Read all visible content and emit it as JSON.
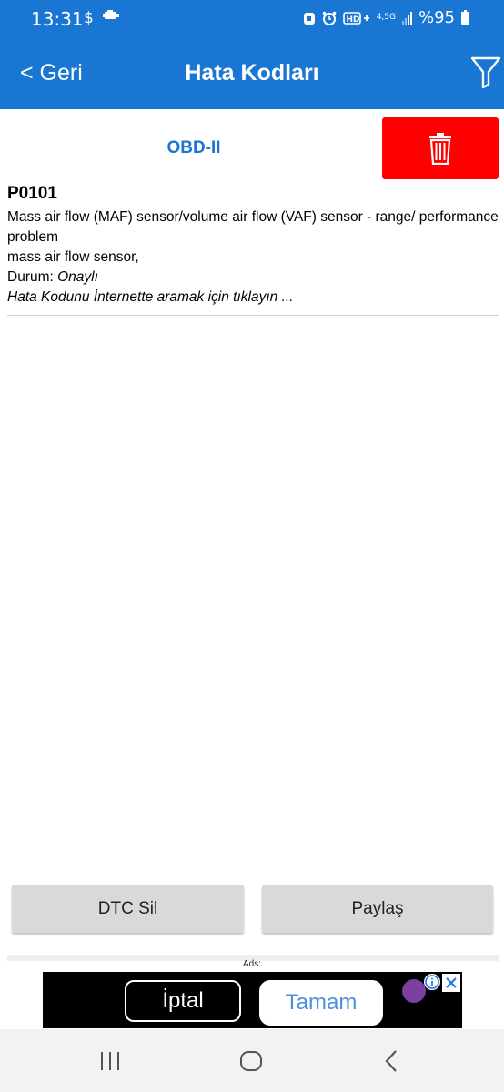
{
  "status_bar": {
    "time": "13:31",
    "network_badge": "4,5G",
    "battery": "%95"
  },
  "header": {
    "back_label": "< Geri",
    "title": "Hata Kodları"
  },
  "segment": {
    "label": "OBD-II"
  },
  "dtc_list": [
    {
      "code": "P0101",
      "description": "Mass air flow (MAF) sensor/volume air flow (VAF) sensor - range/ performance problem",
      "component": "mass air flow sensor,",
      "status_label": "Durum: ",
      "status_value": "Onaylı",
      "search_link": "Hata Kodunu İnternette aramak için tıklayın ..."
    }
  ],
  "actions": {
    "clear_dtc": "DTC Sil",
    "share": "Paylaş"
  },
  "ad": {
    "label": "Ads:",
    "cancel": "İptal",
    "ok": "Tamam"
  },
  "colors": {
    "primary": "#1976d2",
    "delete": "#ff0000"
  }
}
